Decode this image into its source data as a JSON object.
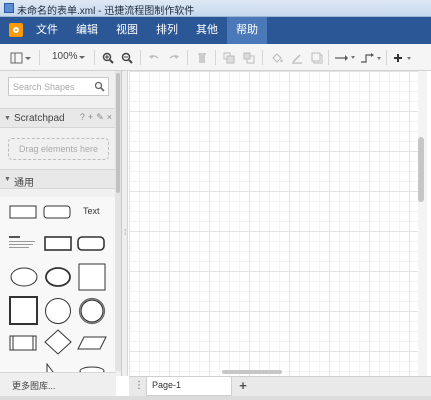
{
  "window": {
    "title": "未命名的表单.xml - 迅捷流程图制作软件"
  },
  "menubar": {
    "items": [
      {
        "label": "文件"
      },
      {
        "label": "编辑"
      },
      {
        "label": "视图"
      },
      {
        "label": "排列"
      },
      {
        "label": "其他"
      },
      {
        "label": "帮助",
        "active": true
      }
    ]
  },
  "toolbar": {
    "zoom": "100%",
    "icons": [
      "format-panel-icon",
      "zoom-in-icon",
      "zoom-out-icon",
      "undo-icon",
      "redo-icon",
      "delete-icon",
      "to-front-icon",
      "to-back-icon",
      "fill-color-icon",
      "line-color-icon",
      "shadow-icon",
      "connection-icon",
      "waypoints-icon",
      "insert-icon"
    ]
  },
  "sidebar": {
    "search_placeholder": "Search Shapes",
    "scratchpad": {
      "label": "Scratchpad",
      "tools": [
        "?",
        "+",
        "✎",
        "×"
      ],
      "drop_hint": "Drag elements here"
    },
    "general": {
      "label": "通用"
    },
    "text_shape_label": "Text",
    "more_libraries": "更多图库..."
  },
  "footer": {
    "page_tab": "Page-1",
    "add_page": "+"
  },
  "colors": {
    "menubar_bg": "#2b5797",
    "menu_active_bg": "#4a78b8",
    "logo_orange": "#ff9900"
  }
}
